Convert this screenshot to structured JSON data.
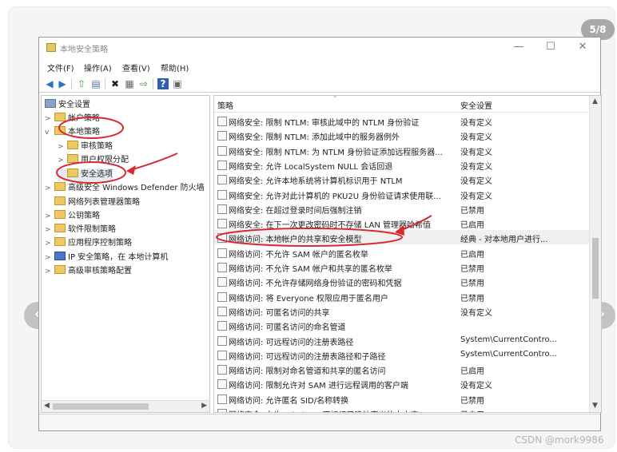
{
  "gallery": {
    "counter": "5/8",
    "prev_icon": "‹",
    "next_icon": "›"
  },
  "watermark": "CSDN @mork9986",
  "window": {
    "title": "本地安全策略",
    "controls": {
      "minimize": "—",
      "maximize": "☐",
      "close": "✕"
    }
  },
  "menu": [
    "文件(F)",
    "操作(A)",
    "查看(V)",
    "帮助(H)"
  ],
  "toolbar_icons": [
    "back-icon",
    "forward-icon",
    "up-folder-icon",
    "show-hide-tree-icon",
    "delete-icon",
    "properties-icon",
    "export-icon",
    "help-icon",
    "view-icon"
  ],
  "tree": {
    "root": "安全设置",
    "items": [
      {
        "label": "帐户策略",
        "expander": ">"
      },
      {
        "label": "本地策略",
        "expander": "v"
      },
      {
        "label": "审核策略",
        "expander": ">"
      },
      {
        "label": "用户权限分配",
        "expander": ">"
      },
      {
        "label": "安全选项",
        "expander": ""
      },
      {
        "label": "高级安全 Windows Defender 防火墙",
        "expander": ">"
      },
      {
        "label": "网络列表管理器策略",
        "expander": ""
      },
      {
        "label": "公钥策略",
        "expander": ">"
      },
      {
        "label": "软件限制策略",
        "expander": ">"
      },
      {
        "label": "应用程序控制策略",
        "expander": ">"
      },
      {
        "label": "IP 安全策略，在 本地计算机",
        "expander": ">"
      },
      {
        "label": "高级审核策略配置",
        "expander": ">"
      }
    ]
  },
  "list": {
    "col_policy": "策略",
    "col_setting": "安全设置",
    "rows": [
      {
        "name": "网络安全: 限制 NTLM: 审核此域中的 NTLM 身份验证",
        "value": "没有定义"
      },
      {
        "name": "网络安全: 限制 NTLM: 添加此域中的服务器例外",
        "value": "没有定义"
      },
      {
        "name": "网络安全: 限制 NTLM: 为 NTLM 身份验证添加远程服务器...",
        "value": "没有定义"
      },
      {
        "name": "网络安全: 允许 LocalSystem NULL 会话回退",
        "value": "没有定义"
      },
      {
        "name": "网络安全: 允许本地系统将计算机标识用于 NTLM",
        "value": "没有定义"
      },
      {
        "name": "网络安全: 允许对此计算机的 PKU2U 身份验证请求使用联...",
        "value": "没有定义"
      },
      {
        "name": "网络安全: 在超过登录时间后强制注销",
        "value": "已禁用"
      },
      {
        "name": "网络安全: 在下一次更改密码时不存储 LAN 管理器哈希值",
        "value": "已启用"
      },
      {
        "name": "网络访问: 本地帐户的共享和安全模型",
        "value": "经典 - 对本地用户进行..."
      },
      {
        "name": "网络访问: 不允许 SAM 帐户的匿名枚举",
        "value": "已启用"
      },
      {
        "name": "网络访问: 不允许 SAM 帐户和共享的匿名枚举",
        "value": "已禁用"
      },
      {
        "name": "网络访问: 不允许存储网络身份验证的密码和凭据",
        "value": "已禁用"
      },
      {
        "name": "网络访问: 将 Everyone 权限应用于匿名用户",
        "value": "已禁用"
      },
      {
        "name": "网络访问: 可匿名访问的共享",
        "value": "没有定义"
      },
      {
        "name": "网络访问: 可匿名访问的命名管道",
        "value": ""
      },
      {
        "name": "网络访问: 可远程访问的注册表路径",
        "value": "System\\CurrentContro..."
      },
      {
        "name": "网络访问: 可远程访问的注册表路径和子路径",
        "value": "System\\CurrentContro..."
      },
      {
        "name": "网络访问: 限制对命名管道和共享的匿名访问",
        "value": "已启用"
      },
      {
        "name": "网络访问: 限制允许对 SAM 进行远程调用的客户端",
        "value": "没有定义"
      },
      {
        "name": "网络访问: 允许匿名 SID/名称转换",
        "value": "已禁用"
      },
      {
        "name": "网络安全: 允许 Windows 不标记了确认定义的由本应",
        "value": "已启用"
      }
    ]
  },
  "colors": {
    "annotation": "#d9282f",
    "folder": "#edc863",
    "window_border": "#9a9a9a"
  }
}
